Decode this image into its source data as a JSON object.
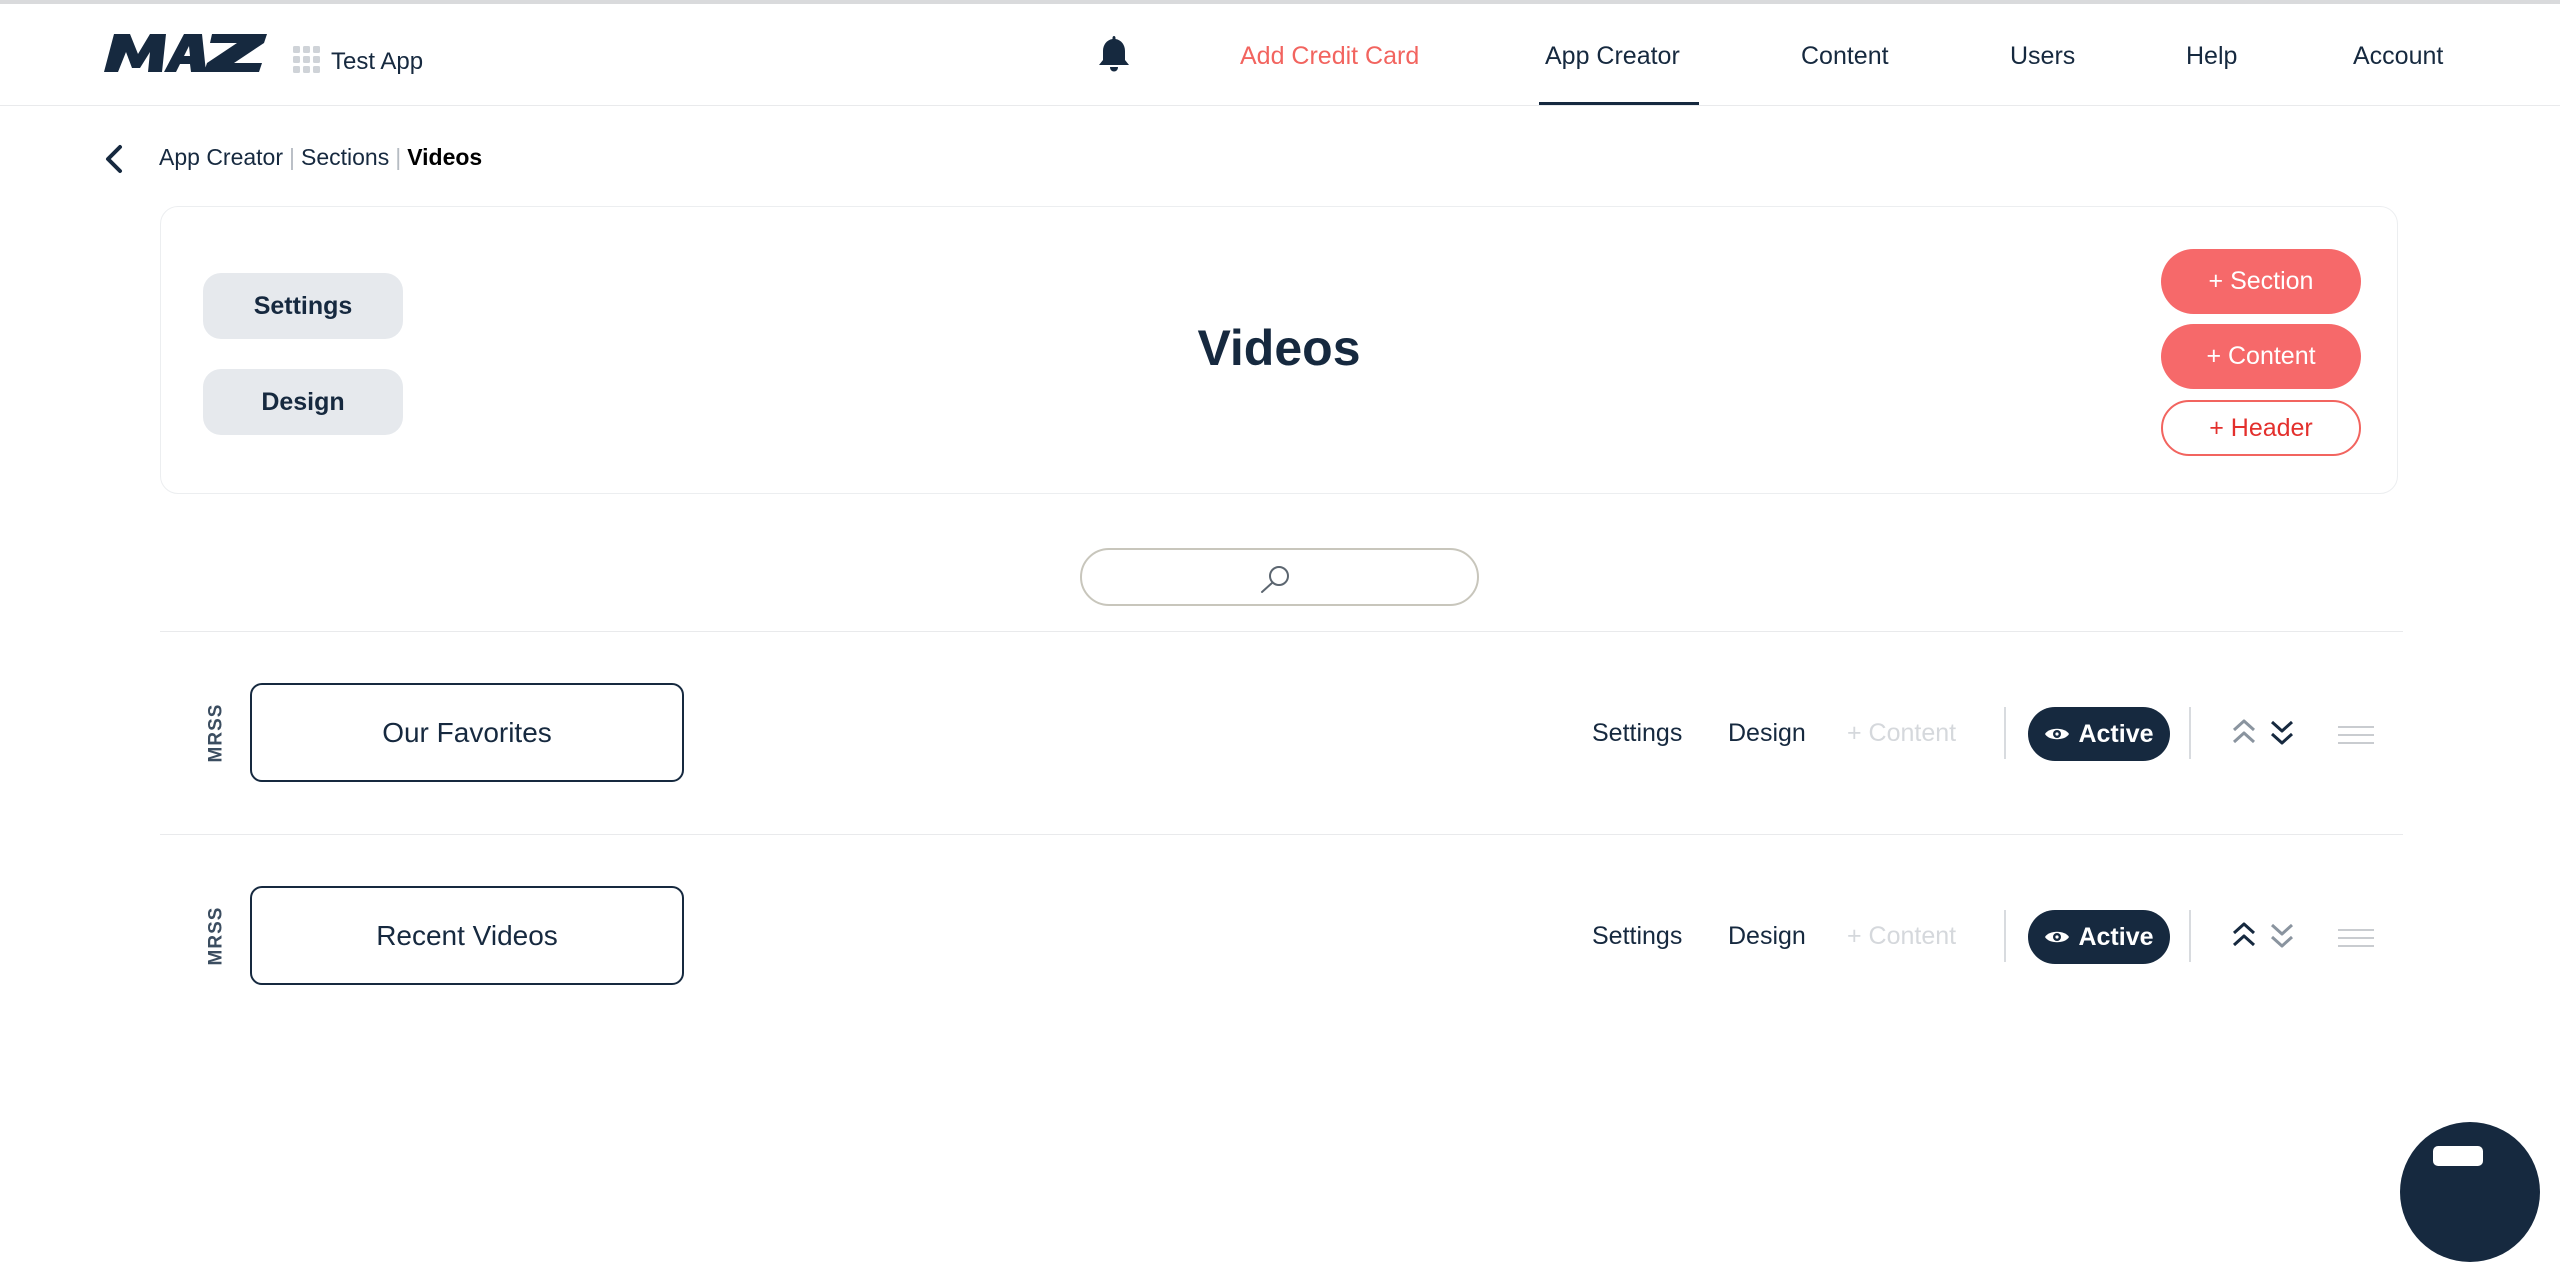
{
  "app": {
    "name": "Test App"
  },
  "nav": {
    "items": [
      {
        "label": "Add Credit Card"
      },
      {
        "label": "App Creator"
      },
      {
        "label": "Content"
      },
      {
        "label": "Users"
      },
      {
        "label": "Help"
      },
      {
        "label": "Account"
      }
    ],
    "active": "App Creator"
  },
  "breadcrumb": {
    "items": [
      "App Creator",
      "Sections",
      "Videos"
    ],
    "separator": "|"
  },
  "section": {
    "title": "Videos",
    "settings_label": "Settings",
    "design_label": "Design",
    "add_section_label": "+ Section",
    "add_content_label": "+ Content",
    "add_header_label": "+ Header"
  },
  "search": {
    "placeholder": "",
    "value": ""
  },
  "rows": [
    {
      "type": "MRSS",
      "name": "Our Favorites",
      "settings": "Settings",
      "design": "Design",
      "add_content": "+ Content",
      "status": "Active"
    },
    {
      "type": "MRSS",
      "name": "Recent Videos",
      "settings": "Settings",
      "design": "Design",
      "add_content": "+ Content",
      "status": "Active"
    }
  ],
  "icons": [
    "logo",
    "apps-grid-icon",
    "bell-icon",
    "back-chevron-icon",
    "search-icon",
    "eye-icon",
    "double-chevron-up-icon",
    "double-chevron-down-icon",
    "drag-handle-icon",
    "chat-icon"
  ],
  "colors": {
    "accent": "#f6696a",
    "navy": "#16293f",
    "header_button_border": "#f2645f"
  }
}
